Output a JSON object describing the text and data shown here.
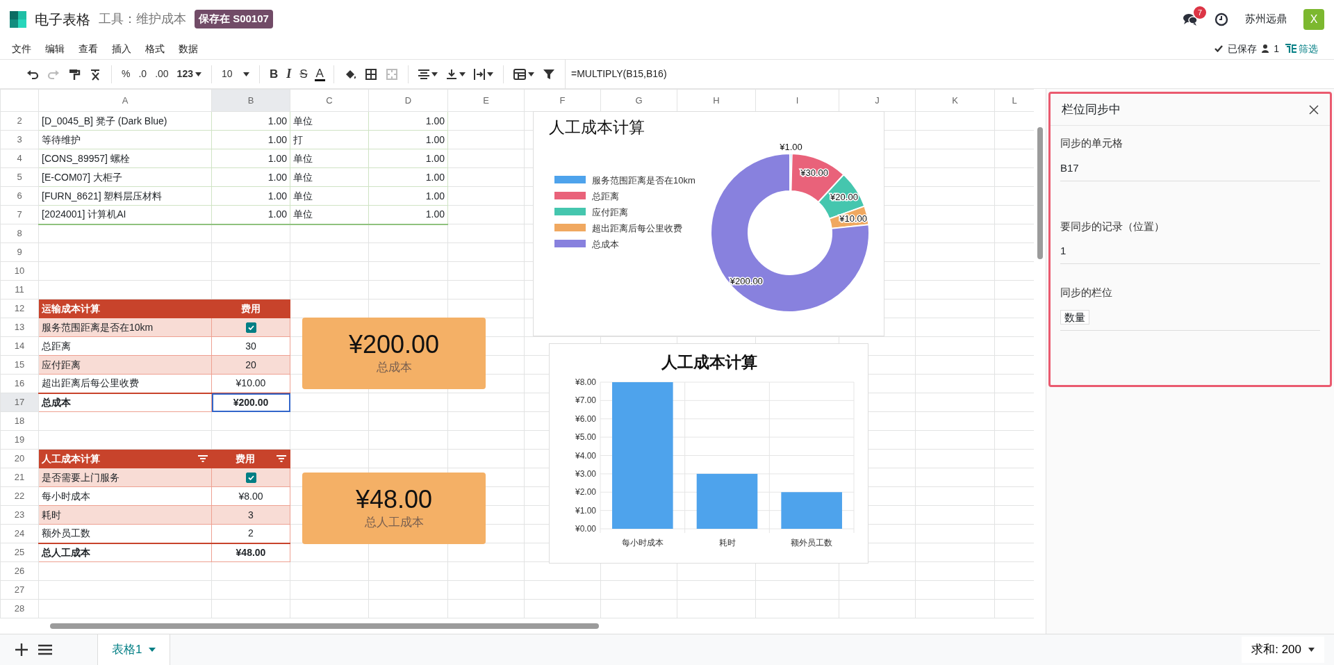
{
  "app": {
    "title": "电子表格",
    "breadcrumb": "工具：维护成本",
    "saved_badge": "保存在 S00107",
    "notifications": "7",
    "user": "苏州远鼎",
    "avatar": "X"
  },
  "menu": [
    "文件",
    "编辑",
    "查看",
    "插入",
    "格式",
    "数据"
  ],
  "status": {
    "saved": "已保存",
    "users": "1",
    "filter": "筛选"
  },
  "toolbar": {
    "number_formats": [
      "%",
      ".0",
      ".00",
      "123"
    ],
    "font_size": "10",
    "text_styles": [
      "B",
      "I",
      "S",
      "A"
    ],
    "formula": "=MULTIPLY(B15,B16)"
  },
  "columns": [
    {
      "letter": "A",
      "selected": false
    },
    {
      "letter": "B",
      "selected": true
    },
    {
      "letter": "C",
      "selected": false
    },
    {
      "letter": "D",
      "selected": false
    },
    {
      "letter": "E",
      "selected": false
    },
    {
      "letter": "F",
      "selected": false
    },
    {
      "letter": "G",
      "selected": false
    },
    {
      "letter": "H",
      "selected": false
    },
    {
      "letter": "I",
      "selected": false
    },
    {
      "letter": "J",
      "selected": false
    },
    {
      "letter": "K",
      "selected": false
    },
    {
      "letter": "L",
      "selected": false
    }
  ],
  "rows": [
    {
      "number": "2",
      "selected": false,
      "kind": "item",
      "cells": [
        "[D_0045_B] 凳子 (Dark Blue)",
        "1.00",
        "单位",
        "1.00"
      ]
    },
    {
      "number": "3",
      "selected": false,
      "kind": "item",
      "cells": [
        "等待维护",
        "1.00",
        "打",
        "1.00"
      ]
    },
    {
      "number": "4",
      "selected": false,
      "kind": "item",
      "cells": [
        "[CONS_89957] 螺栓",
        "1.00",
        "单位",
        "1.00"
      ]
    },
    {
      "number": "5",
      "selected": false,
      "kind": "item",
      "cells": [
        "[E-COM07] 大柜子",
        "1.00",
        "单位",
        "1.00"
      ]
    },
    {
      "number": "6",
      "selected": false,
      "kind": "item",
      "cells": [
        "[FURN_8621] 塑料层压材料",
        "1.00",
        "单位",
        "1.00"
      ]
    },
    {
      "number": "7",
      "selected": false,
      "kind": "item",
      "cells": [
        "[2024001] 计算机AI",
        "1.00",
        "单位",
        "1.00"
      ]
    },
    {
      "number": "8",
      "selected": false,
      "kind": "empty",
      "cells": []
    },
    {
      "number": "9",
      "selected": false,
      "kind": "empty",
      "cells": []
    },
    {
      "number": "10",
      "selected": false,
      "kind": "empty",
      "cells": []
    },
    {
      "number": "11",
      "selected": false,
      "kind": "empty",
      "cells": []
    },
    {
      "number": "12",
      "selected": false,
      "kind": "header",
      "cells": [
        {
          "text": "运输成本计算",
          "filter": false
        },
        {
          "text": "费用",
          "filter": false
        }
      ]
    },
    {
      "number": "13",
      "selected": false,
      "kind": "shaded",
      "cells": [
        "服务范围距离是否在10km",
        {
          "kind": "checkbox",
          "checked": true
        }
      ]
    },
    {
      "number": "14",
      "selected": false,
      "kind": "plain",
      "cells": [
        "总距离",
        "30"
      ]
    },
    {
      "number": "15",
      "selected": false,
      "kind": "shaded",
      "cells": [
        "应付距离",
        "20"
      ]
    },
    {
      "number": "16",
      "selected": false,
      "kind": "plain",
      "cells": [
        "超出距离后每公里收费",
        "¥10.00"
      ]
    },
    {
      "number": "17",
      "selected": true,
      "kind": "total",
      "cells": [
        "总成本",
        "¥200.00"
      ]
    },
    {
      "number": "18",
      "selected": false,
      "kind": "empty",
      "cells": []
    },
    {
      "number": "19",
      "selected": false,
      "kind": "empty",
      "cells": []
    },
    {
      "number": "20",
      "selected": false,
      "kind": "header",
      "cells": [
        {
          "text": "人工成本计算",
          "filter": true
        },
        {
          "text": "费用",
          "filter": true
        }
      ]
    },
    {
      "number": "21",
      "selected": false,
      "kind": "shaded",
      "cells": [
        "是否需要上门服务",
        {
          "kind": "checkbox",
          "checked": true
        }
      ]
    },
    {
      "number": "22",
      "selected": false,
      "kind": "plain",
      "cells": [
        "每小时成本",
        "¥8.00"
      ]
    },
    {
      "number": "23",
      "selected": false,
      "kind": "shaded",
      "cells": [
        "耗时",
        "3"
      ]
    },
    {
      "number": "24",
      "selected": false,
      "kind": "plain",
      "cells": [
        "额外员工数",
        "2"
      ]
    },
    {
      "number": "25",
      "selected": false,
      "kind": "total",
      "cells": [
        "总人工成本",
        "¥48.00"
      ]
    },
    {
      "number": "26",
      "selected": false,
      "kind": "empty",
      "cells": []
    },
    {
      "number": "27",
      "selected": false,
      "kind": "empty",
      "cells": []
    },
    {
      "number": "28",
      "selected": false,
      "kind": "empty",
      "cells": []
    }
  ],
  "scorecards": [
    {
      "value": "¥200.00",
      "label": "总成本"
    },
    {
      "value": "¥48.00",
      "label": "总人工成本"
    }
  ],
  "donut": {
    "chart_data": {
      "type": "donut",
      "title": "人工成本计算",
      "categories": [
        "服务范围距离是否在10km",
        "总距离",
        "应付距离",
        "超出距离后每公里收费",
        "总成本"
      ],
      "values": [
        1,
        30,
        20,
        10,
        200
      ],
      "legend": "left",
      "colors": [
        "#4ea3ec",
        "#e9627a",
        "#45c6ae",
        "#f0a860",
        "#8881de"
      ],
      "value_labels": [
        "¥1.00",
        "¥30.00",
        "¥20.00",
        "¥10.00",
        "¥200.00"
      ]
    }
  },
  "bar": {
    "chart_data": {
      "type": "bar",
      "title": "人工成本计算",
      "categories": [
        "每小时成本",
        "耗时",
        "额外员工数"
      ],
      "series": [
        {
          "color": "#4ea3ec",
          "values": [
            8,
            3,
            2
          ]
        }
      ],
      "grid": true,
      "ylim": [
        0,
        8
      ],
      "yticks": [
        {
          "value": 0,
          "label": "¥0.00"
        },
        {
          "value": 1,
          "label": "¥1.00"
        },
        {
          "value": 2,
          "label": "¥2.00"
        },
        {
          "value": 3,
          "label": "¥3.00"
        },
        {
          "value": 4,
          "label": "¥4.00"
        },
        {
          "value": 5,
          "label": "¥5.00"
        },
        {
          "value": 6,
          "label": "¥6.00"
        },
        {
          "value": 7,
          "label": "¥7.00"
        },
        {
          "value": 8,
          "label": "¥8.00"
        }
      ]
    }
  },
  "panel": {
    "title": "栏位同步中",
    "fields": [
      {
        "label": "同步的单元格",
        "value": "B17",
        "kind": "text"
      },
      {
        "label": "要同步的记录（位置）",
        "value": "1",
        "kind": "text"
      },
      {
        "label": "同步的栏位",
        "value": "数量",
        "kind": "tag"
      }
    ]
  },
  "bottom": {
    "sheet_tab": "表格1",
    "sum": "求和: 200"
  }
}
